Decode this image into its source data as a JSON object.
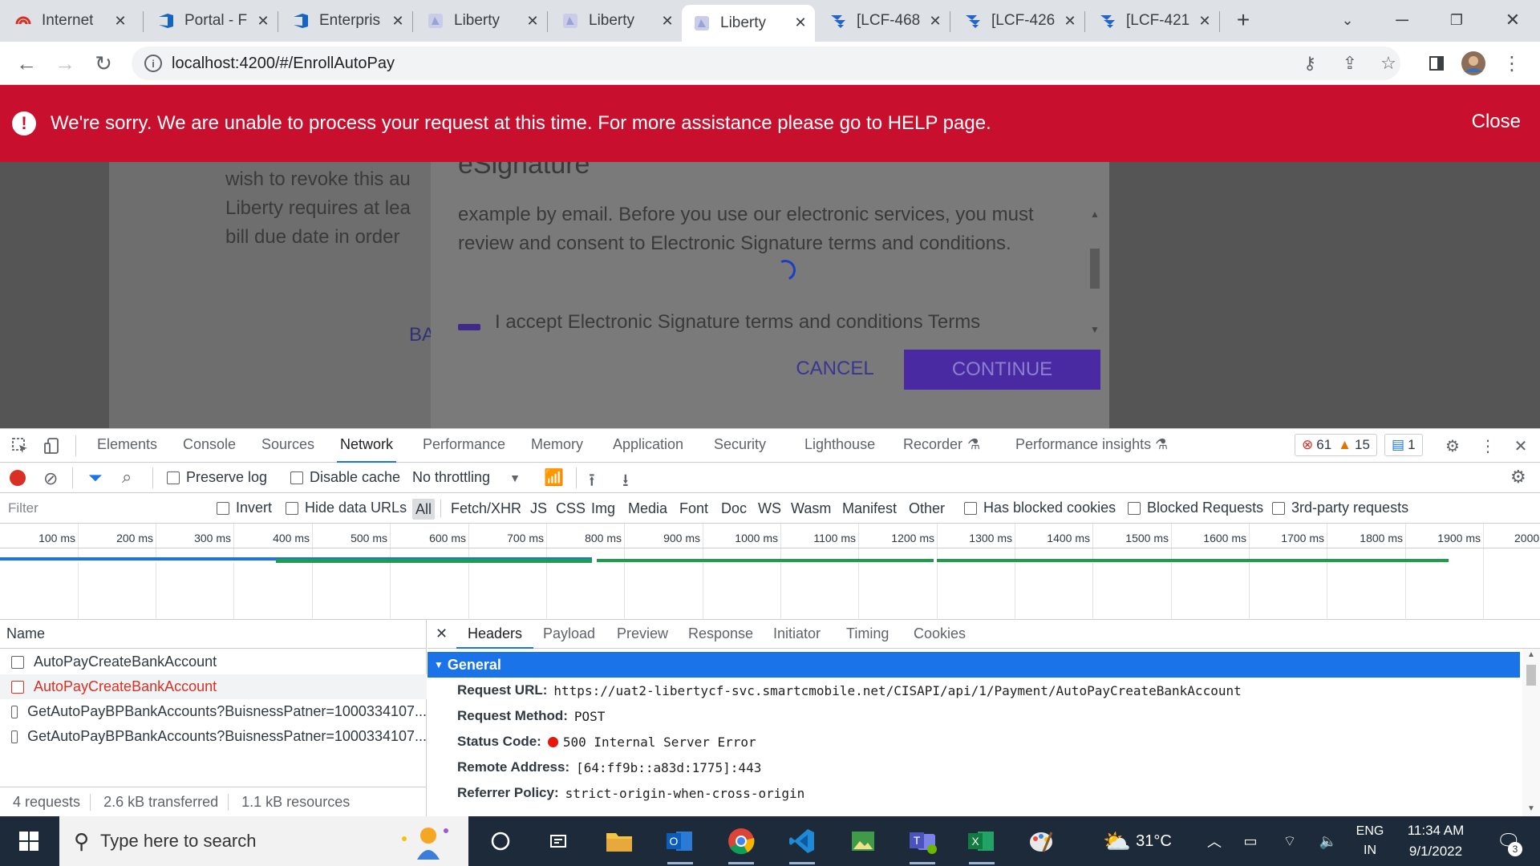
{
  "browser": {
    "tabs": [
      {
        "title": "Internet",
        "icon": "signal-icon"
      },
      {
        "title": "Portal - F",
        "icon": "azure-devops-icon"
      },
      {
        "title": "Enterpris",
        "icon": "azure-devops-icon"
      },
      {
        "title": "Liberty",
        "icon": "liberty-icon"
      },
      {
        "title": "Liberty",
        "icon": "liberty-icon"
      },
      {
        "title": "Liberty",
        "icon": "liberty-icon",
        "active": true
      },
      {
        "title": "[LCF-468",
        "icon": "jira-icon"
      },
      {
        "title": "[LCF-426",
        "icon": "jira-icon"
      },
      {
        "title": "[LCF-421",
        "icon": "jira-icon"
      }
    ],
    "url": "localhost:4200/#/EnrollAutoPay"
  },
  "page": {
    "banner": {
      "message": "We're sorry. We are unable to process your request at this time. For more assistance please go to HELP page.",
      "close_label": "Close",
      "color": "#c8102e"
    },
    "background_lines": [
      "wish to revoke this au",
      "Liberty requires at lea",
      "bill due date in order"
    ],
    "background_back": "BA",
    "modal": {
      "title": "eSignature",
      "body": "example by email. Before you use our electronic services, you must review and consent to Electronic Signature terms and conditions.",
      "checkbox_label": "I accept Electronic Signature terms and conditions Terms",
      "cancel_label": "CANCEL",
      "continue_label": "CONTINUE"
    }
  },
  "devtools": {
    "tabs": [
      "Elements",
      "Console",
      "Sources",
      "Network",
      "Performance",
      "Memory",
      "Application",
      "Security",
      "Lighthouse",
      "Recorder",
      "Performance insights"
    ],
    "active_tab": "Network",
    "errors": "61",
    "warnings": "15",
    "messages": "1",
    "toolbar": {
      "preserve_log": "Preserve log",
      "disable_cache": "Disable cache",
      "throttling": "No throttling"
    },
    "filter": {
      "placeholder": "Filter",
      "invert": "Invert",
      "hide_data_urls": "Hide data URLs",
      "types": [
        "All",
        "Fetch/XHR",
        "JS",
        "CSS",
        "Img",
        "Media",
        "Font",
        "Doc",
        "WS",
        "Wasm",
        "Manifest",
        "Other"
      ],
      "has_blocked_cookies": "Has blocked cookies",
      "blocked_requests": "Blocked Requests",
      "third_party": "3rd-party requests"
    },
    "timeline_ticks": [
      "100 ms",
      "200 ms",
      "300 ms",
      "400 ms",
      "500 ms",
      "600 ms",
      "700 ms",
      "800 ms",
      "900 ms",
      "1000 ms",
      "1100 ms",
      "1200 ms",
      "1300 ms",
      "1400 ms",
      "1500 ms",
      "1600 ms",
      "1700 ms",
      "1800 ms",
      "1900 ms",
      "2000"
    ],
    "requests_header": "Name",
    "requests": [
      {
        "name": "AutoPayCreateBankAccount",
        "error": false
      },
      {
        "name": "AutoPayCreateBankAccount",
        "error": true
      },
      {
        "name": "GetAutoPayBPBankAccounts?BuisnessPatner=1000334107...",
        "error": false
      },
      {
        "name": "GetAutoPayBPBankAccounts?BuisnessPatner=1000334107...",
        "error": false
      }
    ],
    "summary": {
      "requests": "4 requests",
      "transferred": "2.6 kB transferred",
      "resources": "1.1 kB resources"
    },
    "detail_tabs": [
      "Headers",
      "Payload",
      "Preview",
      "Response",
      "Initiator",
      "Timing",
      "Cookies"
    ],
    "general_label": "General",
    "general": [
      {
        "key": "Request URL:",
        "value": "https://uat2-libertycf-svc.smartcmobile.net/CISAPI/api/1/Payment/AutoPayCreateBankAccount"
      },
      {
        "key": "Request Method:",
        "value": "POST"
      },
      {
        "key": "Status Code:",
        "value": "500 Internal Server Error"
      },
      {
        "key": "Remote Address:",
        "value": "[64:ff9b::a83d:1775]:443"
      },
      {
        "key": "Referrer Policy:",
        "value": "strict-origin-when-cross-origin"
      }
    ]
  },
  "taskbar": {
    "search_placeholder": "Type here to search",
    "weather": "31°C",
    "language": "ENG",
    "region": "IN",
    "time": "11:34 AM",
    "date": "9/1/2022",
    "notifications": "3"
  }
}
